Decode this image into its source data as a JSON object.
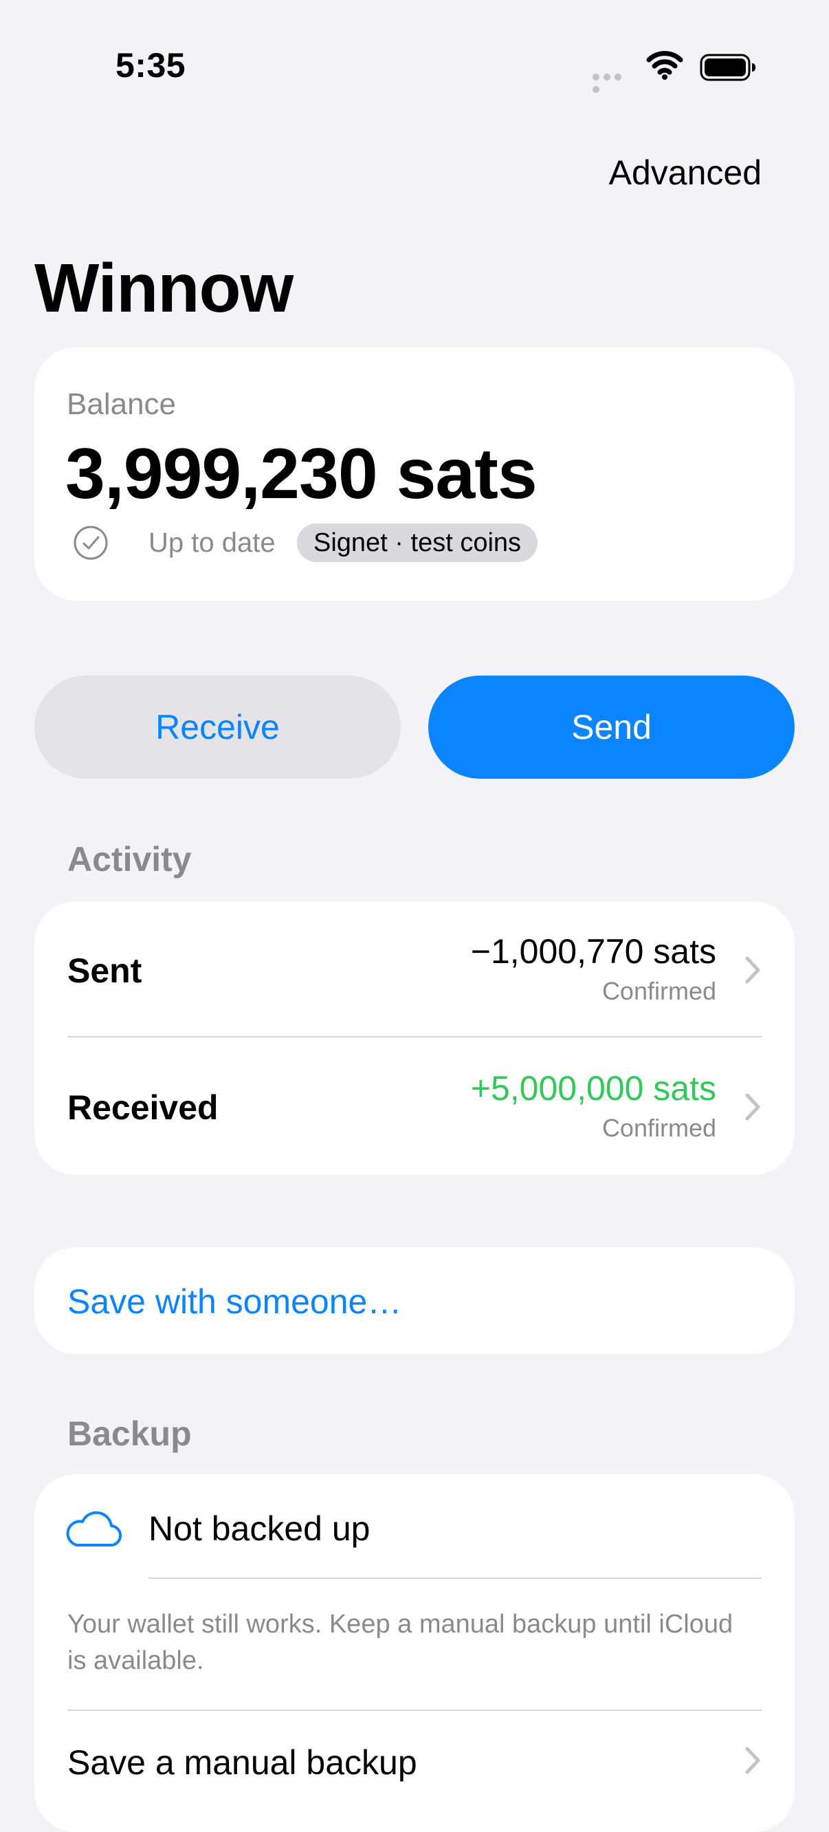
{
  "status_bar": {
    "time": "5:35"
  },
  "header": {
    "advanced_label": "Advanced",
    "title": "Winnow"
  },
  "balance": {
    "label": "Balance",
    "value": "3,999,230 sats",
    "sync_status": "Up to date",
    "network_badge": "Signet · test coins"
  },
  "actions": {
    "receive_label": "Receive",
    "send_label": "Send"
  },
  "activity": {
    "header": "Activity",
    "items": [
      {
        "label": "Sent",
        "amount": "−1,000,770 sats",
        "status": "Confirmed",
        "amount_color": "#000000"
      },
      {
        "label": "Received",
        "amount": "+5,000,000 sats",
        "status": "Confirmed",
        "amount_color": "#34c759"
      }
    ]
  },
  "save_with_someone": {
    "label": "Save with someone…"
  },
  "backup": {
    "header": "Backup",
    "status": "Not backed up",
    "description": "Your wallet still works. Keep a manual backup until iCloud is available.",
    "manual_backup_label": "Save a manual backup"
  },
  "colors": {
    "accent": "#0a84ff",
    "positive": "#34c759",
    "background": "#f2f2f7"
  }
}
